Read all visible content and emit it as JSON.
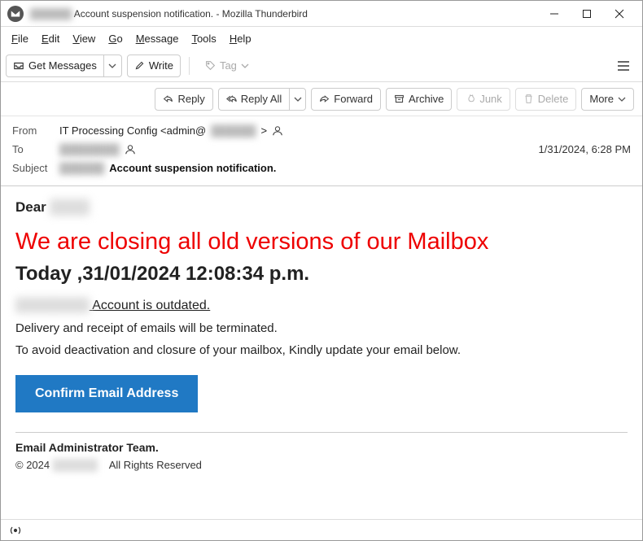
{
  "titlebar": {
    "title_redacted": "██████",
    "title": "Account suspension notification. - Mozilla Thunderbird"
  },
  "menubar": {
    "file": "File",
    "edit": "Edit",
    "view": "View",
    "go": "Go",
    "message": "Message",
    "tools": "Tools",
    "help": "Help"
  },
  "toolbar": {
    "get_messages": "Get Messages",
    "write": "Write",
    "tag": "Tag"
  },
  "actions": {
    "reply": "Reply",
    "reply_all": "Reply All",
    "forward": "Forward",
    "archive": "Archive",
    "junk": "Junk",
    "delete": "Delete",
    "more": "More"
  },
  "headers": {
    "labels": {
      "from": "From",
      "to": "To",
      "subject": "Subject"
    },
    "from_value": "IT Processing Config <admin@",
    "from_suffix": "> ",
    "to_redacted": "████████",
    "date": "1/31/2024, 6:28 PM",
    "subject_redacted": "██████",
    "subject": "Account suspension notification."
  },
  "body": {
    "greeting": "Dear ",
    "greeting_redacted": "████",
    "headline": "We are closing all old versions of our Mailbox",
    "dateline": "Today  ,31/01/2024 12:08:34 p.m.",
    "outdated_redacted": "████████",
    "outdated": "Account is outdated.",
    "p1": "Delivery and receipt of emails will be terminated.",
    "p2": "To avoid deactivation and closure   of your mailbox, Kindly update your email below.",
    "cta": "Confirm Email Address",
    "signature": "Email Administrator Team.",
    "copyright_prefix": "© 2024",
    "copyright_redacted": "██████",
    "copyright_suffix": "All Rights Reserved"
  },
  "statusbar": {
    "icon": "broadcast"
  }
}
